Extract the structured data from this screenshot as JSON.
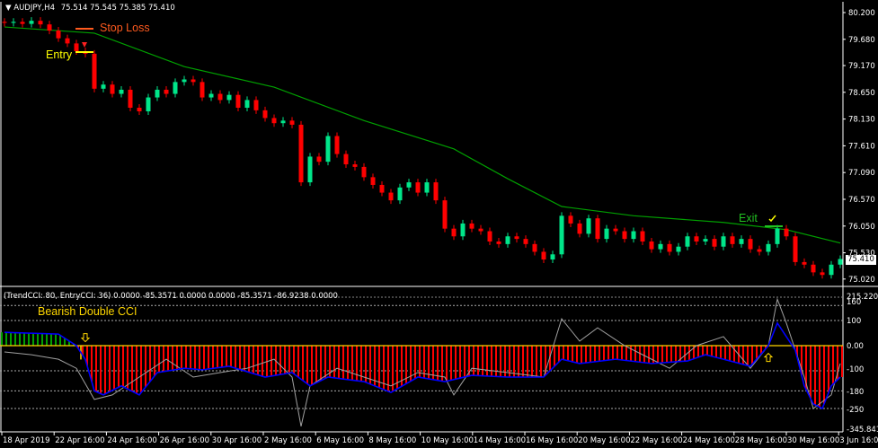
{
  "header": {
    "symbol": "AUDJPY,H4",
    "ohlc": "75.514 75.545 75.385 75.410"
  },
  "indicator_header": "(TrendCCI: 80, EntryCCI: 36)  0.0000 -85.3571 0.0000 0.0000 -85.3571 -86.9238 0.0000",
  "annotations": {
    "stop_loss": "Stop Loss",
    "entry": "Entry",
    "exit": "Exit",
    "indicator_title": "Bearish Double CCI"
  },
  "current_price_label": "75.410",
  "colors": {
    "bull": "#00e68a",
    "bear": "#ff0000",
    "ma": "#00a000",
    "entry_cci": "#0000ff",
    "trend_cci": "#a0a0a0",
    "hist_up": "#00a000",
    "hist_down": "#ff0000",
    "zero_line": "#ffd700",
    "stop_loss": "#ff5a1e",
    "entry": "#ffff00",
    "exit": "#22c022"
  },
  "chart_data": [
    {
      "type": "candlestick",
      "title": "AUDJPY,H4",
      "price_ticks": [
        "80.200",
        "79.680",
        "79.170",
        "78.650",
        "78.130",
        "77.610",
        "77.090",
        "76.570",
        "76.050",
        "75.530",
        "75.020"
      ],
      "ylim": [
        75.02,
        80.2
      ],
      "date_ticks": [
        "18 Apr 2019",
        "22 Apr 16:00",
        "24 Apr 16:00",
        "26 Apr 16:00",
        "30 Apr 16:00",
        "2 May 16:00",
        "6 May 16:00",
        "8 May 16:00",
        "10 May 16:00",
        "14 May 16:00",
        "16 May 16:00",
        "20 May 16:00",
        "22 May 16:00",
        "24 May 16:00",
        "28 May 16:00",
        "30 May 16:00",
        "3 Jun 16:00"
      ],
      "close": [
        80.0,
        80.02,
        79.98,
        80.04,
        79.97,
        79.85,
        79.7,
        79.6,
        79.45,
        79.4,
        78.72,
        78.8,
        78.62,
        78.7,
        78.35,
        78.28,
        78.55,
        78.7,
        78.62,
        78.85,
        78.9,
        78.85,
        78.55,
        78.62,
        78.5,
        78.6,
        78.35,
        78.5,
        78.3,
        78.15,
        78.05,
        78.1,
        78.02,
        76.9,
        77.4,
        77.3,
        77.8,
        77.45,
        77.25,
        77.2,
        77.0,
        76.85,
        76.7,
        76.55,
        76.8,
        76.9,
        76.7,
        76.9,
        76.55,
        76.0,
        75.85,
        76.1,
        76.0,
        75.95,
        75.75,
        75.7,
        75.85,
        75.8,
        75.7,
        75.55,
        75.4,
        75.5,
        76.25,
        76.1,
        75.9,
        76.2,
        75.8,
        76.0,
        75.95,
        75.8,
        75.95,
        75.75,
        75.6,
        75.7,
        75.55,
        75.65,
        75.85,
        75.75,
        75.8,
        75.65,
        75.85,
        75.7,
        75.8,
        75.6,
        75.55,
        75.7,
        76.0,
        75.85,
        75.35,
        75.3,
        75.15,
        75.1,
        75.3,
        75.41
      ],
      "moving_average": {
        "index": [
          0,
          10,
          20,
          30,
          40,
          50,
          56,
          62,
          70,
          80,
          87,
          93
        ],
        "value": [
          79.92,
          79.8,
          79.15,
          78.75,
          78.1,
          77.55,
          76.97,
          76.43,
          76.25,
          76.12,
          75.98,
          75.72
        ]
      }
    },
    {
      "type": "line",
      "title": "Bearish Double CCI",
      "yticks": [
        "215.2202",
        "160",
        "100",
        "0.00",
        "-100",
        "-180",
        "-250",
        "-345.8413"
      ],
      "levels": [
        160,
        100,
        0,
        -100,
        -180,
        -250
      ],
      "ylim": [
        -345.8413,
        215.2202
      ],
      "series": [
        {
          "name": "EntryCCI",
          "index": [
            0,
            6,
            8,
            9,
            10,
            11,
            13,
            15,
            17,
            20,
            22,
            25,
            29,
            32,
            34,
            36,
            40,
            43,
            46,
            49,
            52,
            56,
            60,
            62,
            64,
            68,
            72,
            76,
            78,
            80,
            83,
            85,
            86,
            88,
            89,
            90,
            91,
            92,
            93
          ],
          "values": [
            53,
            46,
            0,
            -55,
            -180,
            -196,
            -160,
            -196,
            -107,
            -90,
            -96,
            -82,
            -125,
            -107,
            -160,
            -125,
            -143,
            -186,
            -125,
            -143,
            -118,
            -125,
            -125,
            -54,
            -71,
            -54,
            -71,
            -61,
            -36,
            -54,
            -82,
            0,
            90,
            -18,
            -160,
            -232,
            -250,
            -160,
            -125
          ]
        },
        {
          "name": "TrendCCI",
          "index": [
            0,
            3,
            6,
            8,
            10,
            12,
            15,
            18,
            21,
            24,
            27,
            30,
            32,
            33,
            34,
            37,
            40,
            43,
            46,
            49,
            50,
            52,
            56,
            60,
            62,
            64,
            66,
            69,
            72,
            74,
            77,
            80,
            83,
            85,
            86,
            87,
            89,
            90,
            92,
            93
          ],
          "values": [
            -25,
            -36,
            -54,
            -90,
            -214,
            -196,
            -125,
            -54,
            -125,
            -107,
            -90,
            -54,
            -125,
            -321,
            -160,
            -90,
            -125,
            -160,
            -107,
            -125,
            -196,
            -90,
            -107,
            -125,
            107,
            18,
            71,
            0,
            -54,
            -90,
            0,
            36,
            -90,
            0,
            185,
            90,
            -125,
            -250,
            -196,
            -71
          ]
        }
      ],
      "histogram_green_until_index": 8,
      "markers": [
        {
          "type": "down-arrow",
          "index": 9,
          "value": 30
        },
        {
          "type": "up-arrow",
          "index": 85,
          "value": -45
        }
      ]
    }
  ]
}
